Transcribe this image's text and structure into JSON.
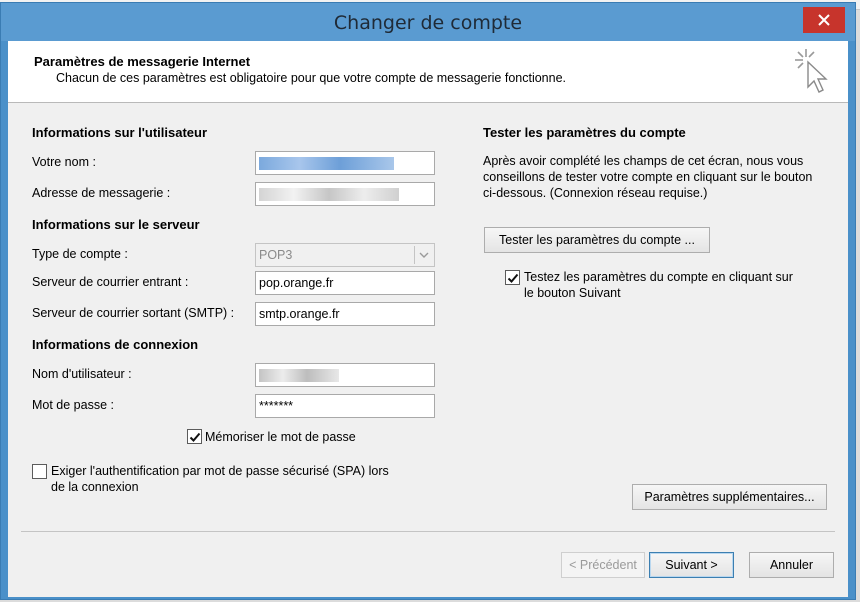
{
  "window": {
    "title": "Changer de compte"
  },
  "header": {
    "title": "Paramètres de messagerie Internet",
    "description": "Chacun de ces paramètres est obligatoire pour que votre compte de messagerie fonctionne."
  },
  "user_info": {
    "section_title": "Informations sur l'utilisateur",
    "name_label": "Votre nom :",
    "email_label": "Adresse de messagerie :"
  },
  "server_info": {
    "section_title": "Informations sur le serveur",
    "account_type_label": "Type de compte :",
    "account_type_value": "POP3",
    "incoming_label": "Serveur de courrier entrant :",
    "incoming_value": "pop.orange.fr",
    "outgoing_label": "Serveur de courrier sortant (SMTP) :",
    "outgoing_value": "smtp.orange.fr"
  },
  "login_info": {
    "section_title": "Informations de connexion",
    "username_label": "Nom d'utilisateur :",
    "password_label": "Mot de passe :",
    "password_value": "*******",
    "remember_label": "Mémoriser le mot de passe",
    "remember_checked": true,
    "spa_label_line1": "Exiger l'authentification par mot de passe sécurisé (SPA) lors",
    "spa_label_line2": "de la connexion",
    "spa_checked": false
  },
  "test_panel": {
    "section_title": "Tester les paramètres du compte",
    "description_line1": "Après avoir complété les champs de cet écran, nous vous",
    "description_line2": "conseillons de tester votre compte en cliquant sur le bouton",
    "description_line3": "ci-dessous. (Connexion réseau requise.)",
    "test_button": "Tester les paramètres du compte ...",
    "auto_test_line1": "Testez les paramètres du compte en cliquant sur",
    "auto_test_line2": "le bouton Suivant",
    "auto_test_checked": true,
    "more_settings_button": "Paramètres supplémentaires..."
  },
  "footer": {
    "back_button": "< Précédent",
    "next_button": "Suivant >",
    "cancel_button": "Annuler"
  },
  "colors": {
    "title_bar": "#5a9bd1",
    "close_button": "#c7342c",
    "dialog_bg": "#f0f0f0"
  }
}
